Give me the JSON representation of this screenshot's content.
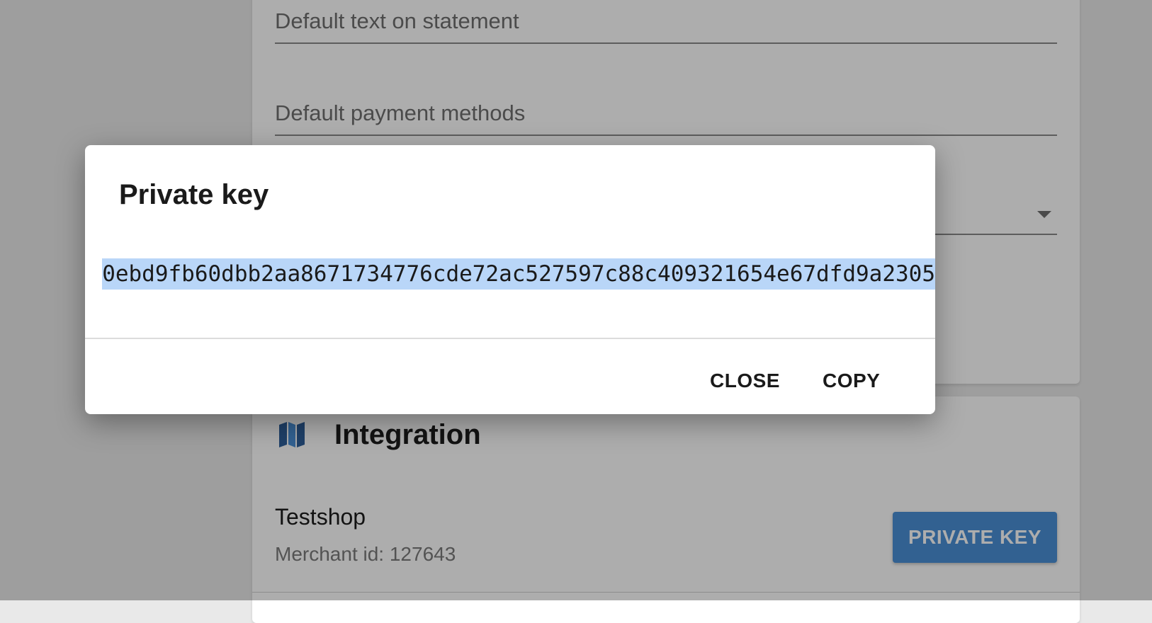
{
  "settings": {
    "statement_label": "Default text on statement",
    "methods_label": "Default payment methods"
  },
  "integration": {
    "title": "Integration",
    "icon": "map-icon",
    "shop_name": "Testshop",
    "merchant_id": "Merchant id: 127643",
    "private_key_button": "PRIVATE KEY"
  },
  "dialog": {
    "title": "Private key",
    "key_value": "0ebd9fb60dbb2aa8671734776cde72ac527597c88c409321654e67dfd9a2305",
    "close_label": "CLOSE",
    "copy_label": "COPY"
  },
  "colors": {
    "accent": "#4a8fd6",
    "selection": "#b9d6f8"
  }
}
